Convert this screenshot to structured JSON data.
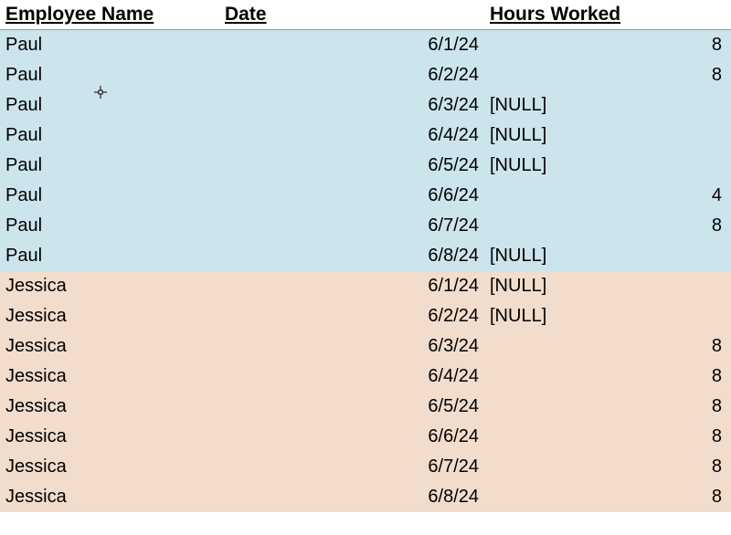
{
  "headers": {
    "name": "Employee Name",
    "date": "Date",
    "hours": "Hours Worked"
  },
  "null_text": "[NULL]",
  "rows": [
    {
      "group": "paul",
      "name": "Paul",
      "date": "6/1/24",
      "hours": "8"
    },
    {
      "group": "paul",
      "name": "Paul",
      "date": "6/2/24",
      "hours": "8"
    },
    {
      "group": "paul",
      "name": "Paul",
      "date": "6/3/24",
      "hours": null
    },
    {
      "group": "paul",
      "name": "Paul",
      "date": "6/4/24",
      "hours": null
    },
    {
      "group": "paul",
      "name": "Paul",
      "date": "6/5/24",
      "hours": null
    },
    {
      "group": "paul",
      "name": "Paul",
      "date": "6/6/24",
      "hours": "4"
    },
    {
      "group": "paul",
      "name": "Paul",
      "date": "6/7/24",
      "hours": "8"
    },
    {
      "group": "paul",
      "name": "Paul",
      "date": "6/8/24",
      "hours": null
    },
    {
      "group": "jessica",
      "name": "Jessica",
      "date": "6/1/24",
      "hours": null
    },
    {
      "group": "jessica",
      "name": "Jessica",
      "date": "6/2/24",
      "hours": null
    },
    {
      "group": "jessica",
      "name": "Jessica",
      "date": "6/3/24",
      "hours": "8"
    },
    {
      "group": "jessica",
      "name": "Jessica",
      "date": "6/4/24",
      "hours": "8"
    },
    {
      "group": "jessica",
      "name": "Jessica",
      "date": "6/5/24",
      "hours": "8"
    },
    {
      "group": "jessica",
      "name": "Jessica",
      "date": "6/6/24",
      "hours": "8"
    },
    {
      "group": "jessica",
      "name": "Jessica",
      "date": "6/7/24",
      "hours": "8"
    },
    {
      "group": "jessica",
      "name": "Jessica",
      "date": "6/8/24",
      "hours": "8"
    }
  ]
}
